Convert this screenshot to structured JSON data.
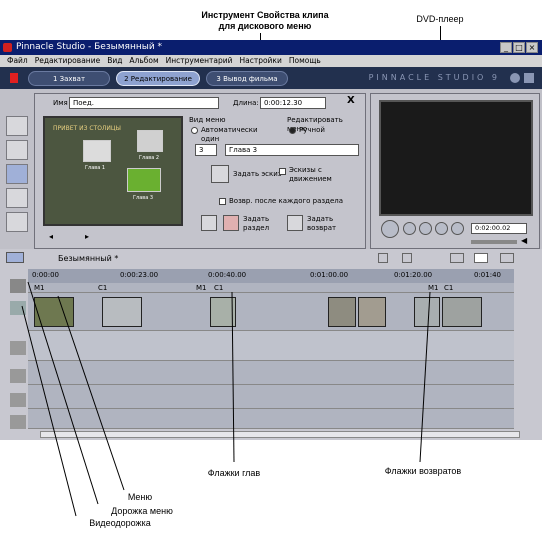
{
  "annotations": {
    "clip_properties_tool": "Инструмент Свойства клипа\nдля дискового меню",
    "dvd_player": "DVD-плеер",
    "chapter_flags": "Флажки глав",
    "return_flags": "Флажки возвратов",
    "menu": "Меню",
    "menu_track": "Дорожка меню",
    "video_track": "Видеодорожка"
  },
  "window": {
    "title": "Pinnacle Studio - Безымянный *"
  },
  "menubar": [
    "Файл",
    "Редактирование",
    "Вид",
    "Альбом",
    "Инструментарий",
    "Настройки",
    "Помощь"
  ],
  "tabs": [
    {
      "label": "1 Захват"
    },
    {
      "label": "2 Редактирование"
    },
    {
      "label": "3 Вывод фильма"
    }
  ],
  "brand": "PINNACLE STUDIO 9",
  "clip_panel": {
    "name_label": "Имя",
    "name_value": "Поед.",
    "duration_label": "Длина:",
    "duration_value": "0:00:12.30",
    "close_glyph": "X",
    "view_menu_label": "Вид меню",
    "edit_menu_label": "Редактировать меню",
    "auto_option": "Автоматически",
    "auto_option2": "один",
    "manual_option": "Ручной",
    "chapter_number": "3",
    "chapter_name": "Глава 3",
    "set_thumbnail": "Задать эскиз",
    "motion_thumbs_1": "Эскизы с",
    "motion_thumbs_2": "движением",
    "return_after": "Возвр. после каждого раздела",
    "set_chapter_1": "Задать",
    "set_chapter_2": "раздел",
    "set_return_1": "Задать",
    "set_return_2": "возврат",
    "preview_title": "ПРИВЕТ ИЗ СТОЛИЦЫ",
    "thumb_labels": [
      "Глава 1",
      "Глава 2",
      "Глава 3"
    ]
  },
  "player": {
    "timecode": "0:02:00.02"
  },
  "timeline": {
    "project_name": "Безымянный *",
    "ruler_labels": [
      "0:00:00",
      "0:00:23.00",
      "0:00:40.00",
      "0:01:00.00",
      "0:01:20.00",
      "0:01:40"
    ],
    "markers": [
      "M1",
      "C1",
      "M1",
      "C1",
      "M1",
      "C1"
    ]
  }
}
